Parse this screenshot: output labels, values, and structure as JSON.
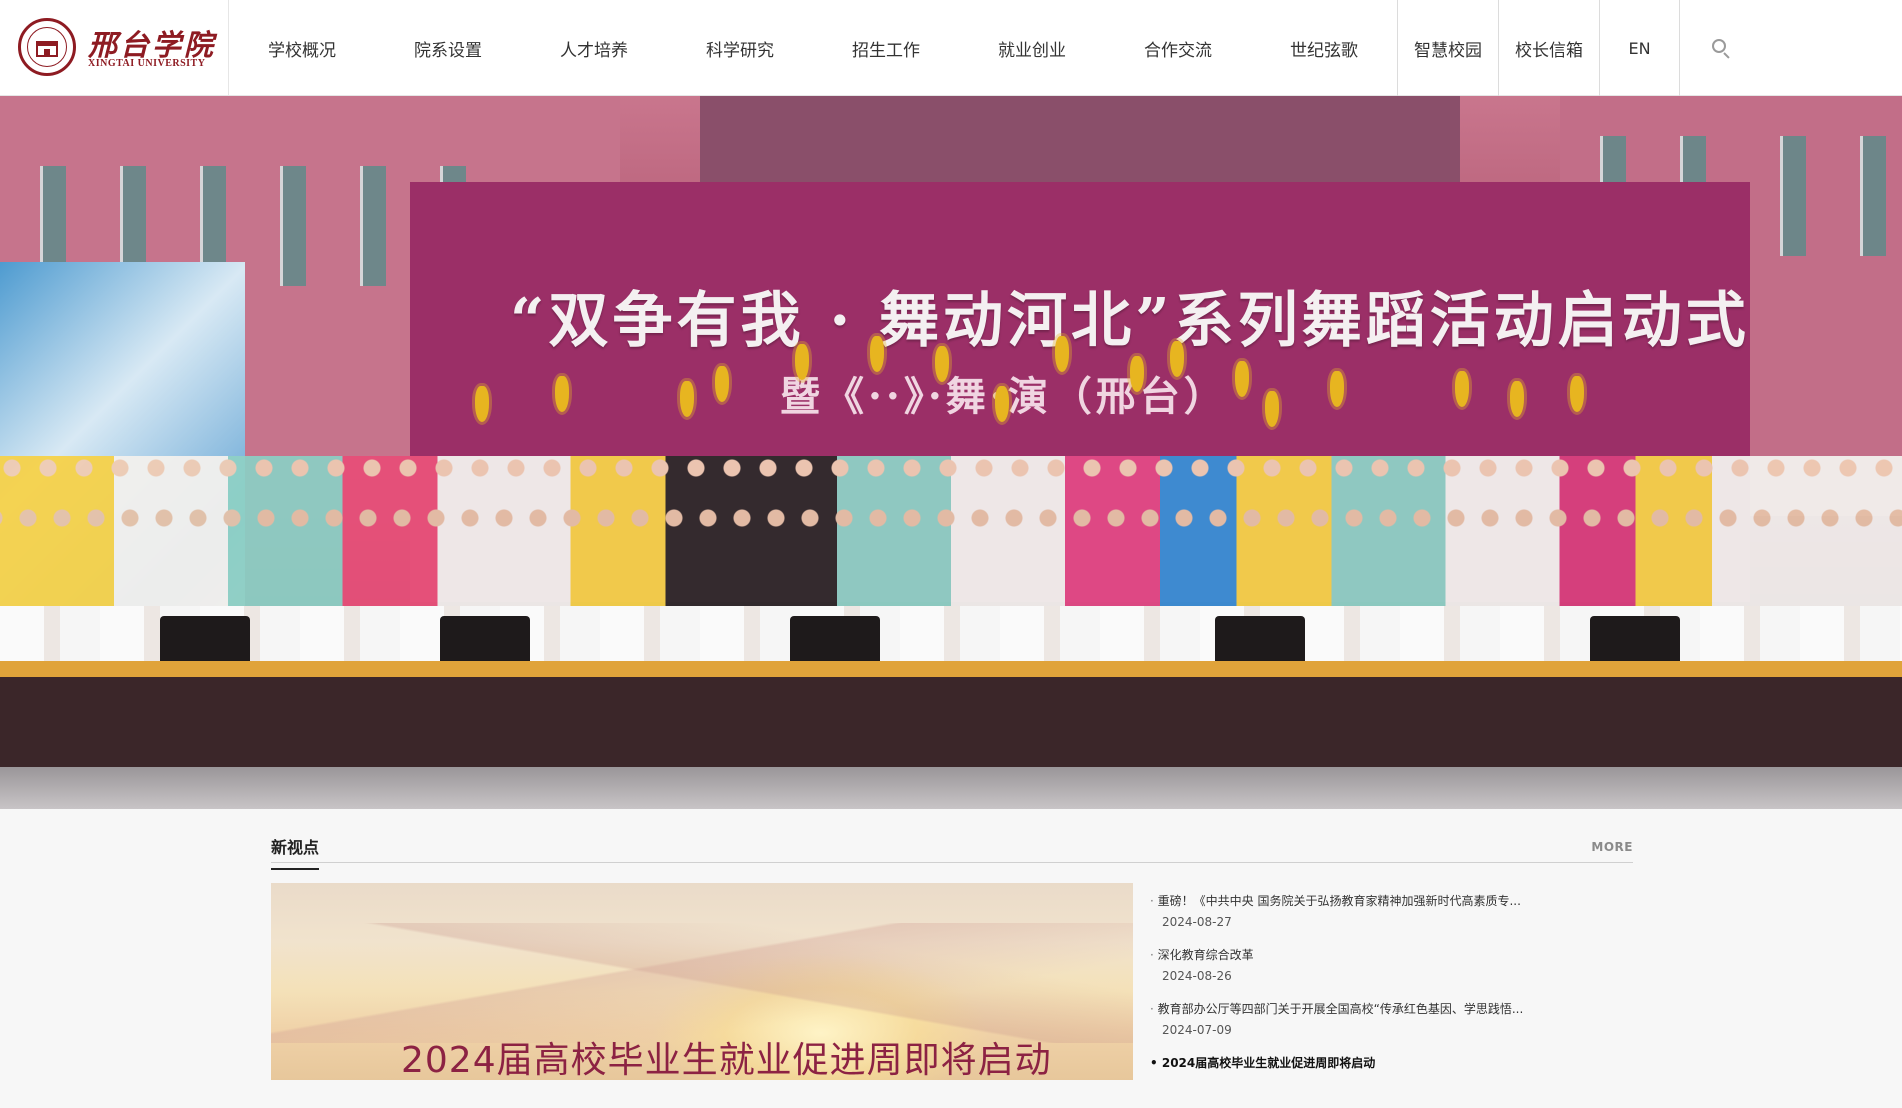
{
  "logo": {
    "name_cn": "邢台学院",
    "name_en": "XINGTAI UNIVERSITY"
  },
  "nav": [
    {
      "label": "学校概况"
    },
    {
      "label": "院系设置"
    },
    {
      "label": "人才培养"
    },
    {
      "label": "科学研究"
    },
    {
      "label": "招生工作"
    },
    {
      "label": "就业创业"
    },
    {
      "label": "合作交流"
    },
    {
      "label": "世纪弦歌"
    }
  ],
  "quick_links": [
    {
      "label": "智慧校园"
    },
    {
      "label": "校长信箱"
    },
    {
      "label": "EN"
    }
  ],
  "search": {
    "icon": "search-icon"
  },
  "banner": {
    "title": "“双争有我 · 舞动河北”系列舞蹈活动启动式",
    "subtitle": "暨《··》·舞·演（邢台）"
  },
  "news": {
    "section_title": "新视点",
    "more_label": "MORE",
    "feature_caption": "2024届高校毕业生就业促进周即将启动",
    "items": [
      {
        "title": "重磅！《中共中央 国务院关于弘扬教育家精神加强新时代高素质专...",
        "date": "2024-08-27"
      },
      {
        "title": "深化教育综合改革",
        "date": "2024-08-26"
      },
      {
        "title": "教育部办公厅等四部门关于开展全国高校“传承红色基因、学思践悟...",
        "date": "2024-07-09"
      },
      {
        "title": "2024届高校毕业生就业促进周即将启动",
        "date": ""
      }
    ]
  },
  "colors": {
    "brand": "#8e1b22",
    "banner_backdrop": "#9b2f67",
    "feature_caption": "#8c2243"
  }
}
